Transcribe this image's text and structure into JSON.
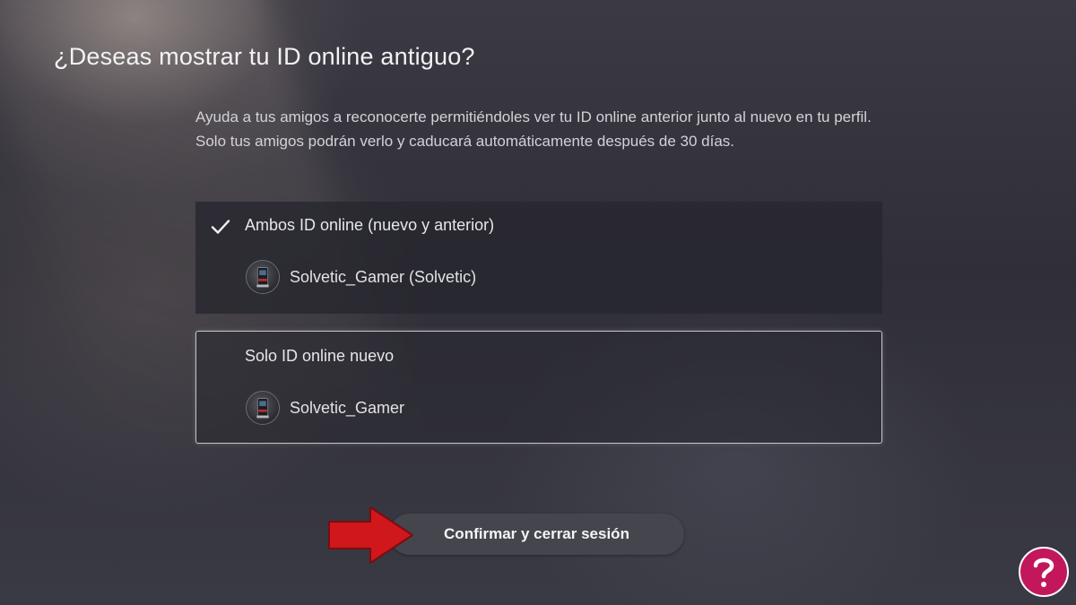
{
  "dialog": {
    "title": "¿Deseas mostrar tu ID online antiguo?",
    "description": "Ayuda a tus amigos a reconocerte permitiéndoles ver tu ID online anterior junto al nuevo en tu perfil. Solo tus amigos podrán verlo y caducará automáticamente después de 30 días."
  },
  "options": [
    {
      "label": "Ambos ID online (nuevo y anterior)",
      "user": "Solvetic_Gamer (Solvetic)",
      "selected": true,
      "focused": false
    },
    {
      "label": "Solo ID online nuevo",
      "user": "Solvetic_Gamer",
      "selected": false,
      "focused": true
    }
  ],
  "confirm_button": {
    "label": "Confirmar y cerrar sesión"
  },
  "annotation": {
    "arrow_color": "#d0171c"
  },
  "logo": {
    "color": "#c2185b"
  },
  "icons": [
    "checkmark-icon",
    "avatar-icon",
    "arrow-annotation-icon",
    "watermark-logo-icon"
  ]
}
